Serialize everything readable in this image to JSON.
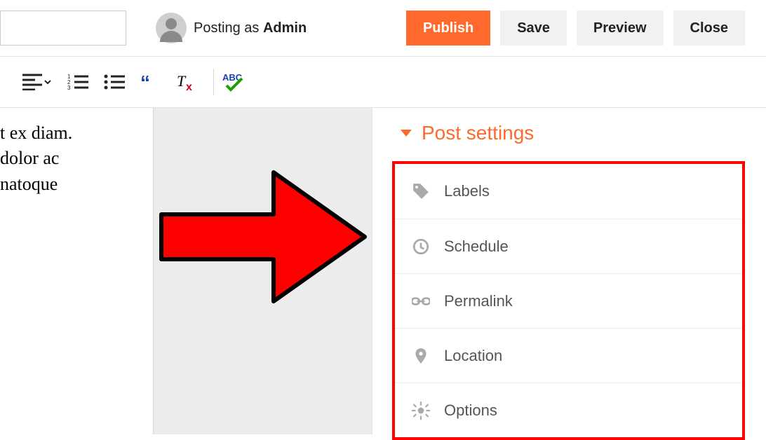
{
  "header": {
    "posting_as_prefix": "Posting as ",
    "posting_as_user": "Admin",
    "publish": "Publish",
    "save": "Save",
    "preview": "Preview",
    "close": "Close"
  },
  "editor": {
    "line1": "t ex diam.",
    "line2": "dolor ac",
    "line3": " natoque"
  },
  "post_settings": {
    "title": "Post settings",
    "items": [
      {
        "label": "Labels"
      },
      {
        "label": "Schedule"
      },
      {
        "label": "Permalink"
      },
      {
        "label": "Location"
      },
      {
        "label": "Options"
      }
    ]
  }
}
